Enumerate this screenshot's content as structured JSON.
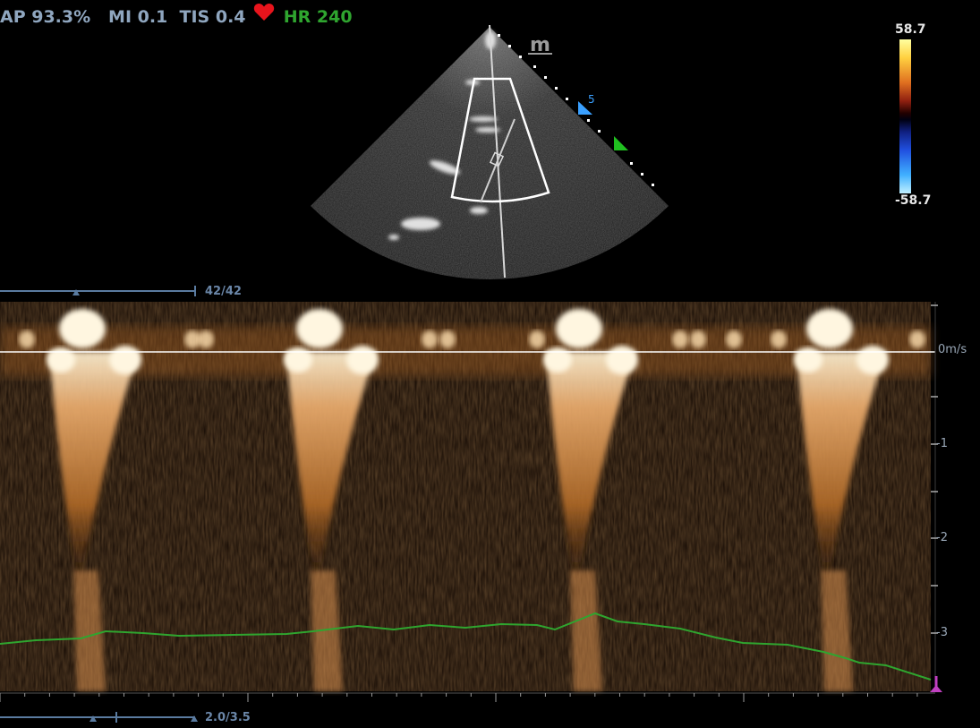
{
  "header": {
    "ap": "AP 93.3%",
    "mi": "MI 0.1",
    "tis": "TIS 0.4",
    "hr": "HR 240",
    "hr_color": "#2fa52f",
    "heart_color": "#e8141c",
    "heart_icon": "heart-icon"
  },
  "probe_mark": "m",
  "focus_marker": "5",
  "color_scale": {
    "max": "58.7",
    "min": "-58.7"
  },
  "top_slider": {
    "value": "42/42"
  },
  "bottom_slider": {
    "value": "2.0/3.5"
  },
  "velocity_scale": {
    "unit_label": "0m/s",
    "ticks": [
      "-1",
      "-2",
      "-3"
    ]
  },
  "colors": {
    "spectral": "#ffb060",
    "ecg_trace": "#2fa52f",
    "baseline": "#ffffff",
    "marker": "#c040c0"
  }
}
